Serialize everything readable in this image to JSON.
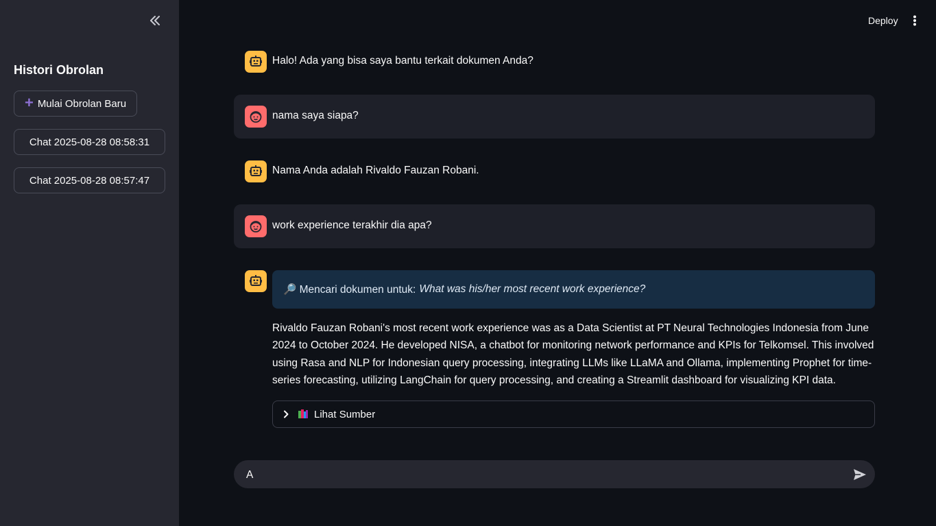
{
  "sidebar": {
    "title": "Histori Obrolan",
    "new_chat_label": "Mulai Obrolan Baru",
    "history": [
      {
        "label": "Chat 2025-08-28 08:58:31"
      },
      {
        "label": "Chat 2025-08-28 08:57:47"
      }
    ]
  },
  "header": {
    "deploy_label": "Deploy"
  },
  "messages": [
    {
      "role": "assistant",
      "text": "Halo! Ada yang bisa saya bantu terkait dokumen Anda?"
    },
    {
      "role": "user",
      "text": "nama saya siapa?"
    },
    {
      "role": "assistant",
      "text": "Nama Anda adalah Rivaldo Fauzan Robani."
    },
    {
      "role": "user",
      "text": "work experience terakhir dia apa?"
    },
    {
      "role": "assistant",
      "info_prefix": "🔎 Mencari dokumen untuk:",
      "info_query": "What was his/her most recent work experience?",
      "text": "Rivaldo Fauzan Robani's most recent work experience was as a Data Scientist at PT Neural Technologies Indonesia from June 2024 to October 2024. He developed NISA, a chatbot for monitoring network performance and KPIs for Telkomsel. This involved using Rasa and NLP for Indonesian query processing, integrating LLMs like LLaMA and Ollama, implementing Prophet for time-series forecasting, utilizing LangChain for query processing, and creating a Streamlit dashboard for visualizing KPI data.",
      "expander_label": "Lihat Sumber"
    }
  ],
  "chat_input": {
    "value": "A"
  },
  "colors": {
    "background": "#0e1117",
    "sidebar": "#262730",
    "user_bubble": "#1e2029",
    "bot_avatar": "#ffbd45",
    "user_avatar": "#ff6c6c",
    "info_box": "#172d43",
    "accent_plus": "#8b6fd0"
  }
}
